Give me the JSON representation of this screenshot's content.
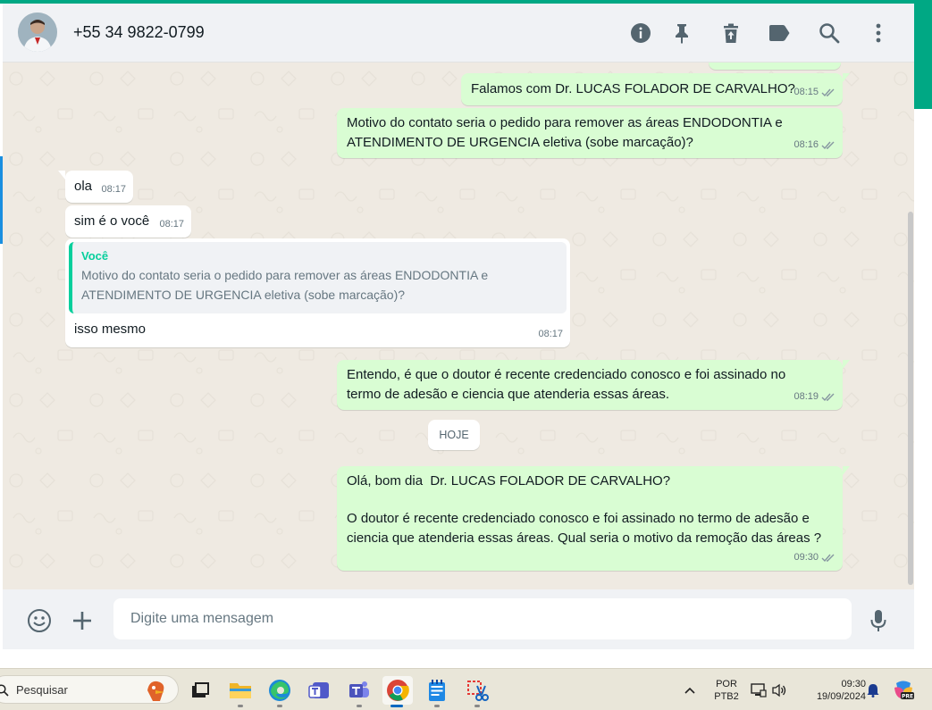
{
  "header": {
    "contact_name": "+55 34 9822-0799",
    "icons": [
      "info-icon",
      "pin-icon",
      "delete-icon",
      "label-icon",
      "search-icon",
      "menu-icon"
    ]
  },
  "messages": [
    {
      "type": "out",
      "text": "Falamos com Dr. LUCAS FOLADOR DE CARVALHO?",
      "time": "08:15"
    },
    {
      "type": "out",
      "text": "Motivo do contato seria o pedido para remover as áreas ENDODONTIA e ATENDIMENTO DE URGENCIA eletiva (sobe marcação)?",
      "time": "08:16"
    },
    {
      "type": "in",
      "text": "ola",
      "time": "08:17"
    },
    {
      "type": "in",
      "text": "sim é o você",
      "time": "08:17"
    },
    {
      "type": "in_reply",
      "quote_author": "Você",
      "quote_text": "Motivo do contato seria o pedido para remover as áreas ENDODONTIA e ATENDIMENTO DE URGENCIA eletiva (sobe marcação)?",
      "text": "isso mesmo",
      "time": "08:17"
    },
    {
      "type": "out",
      "text": "Entendo, é que o doutor é recente credenciado conosco e foi assinado no termo de adesão e ciencia que atenderia essas áreas.",
      "time": "08:19"
    },
    {
      "type": "out",
      "text_line1": "Olá, bom dia  Dr. LUCAS FOLADOR DE CARVALHO?",
      "text_line2": "O doutor é recente credenciado conosco e foi assinado no termo de adesão e ciencia que atenderia essas áreas. Qual seria o motivo da remoção das áreas ?",
      "time": "09:30"
    }
  ],
  "date_separator": "HOJE",
  "composer": {
    "placeholder": "Digite uma mensagem"
  },
  "taskbar": {
    "search_label": "Pesquisar",
    "language_line1": "POR",
    "language_line2": "PTB2",
    "time": "09:30",
    "date": "19/09/2024",
    "badge": "PRE"
  },
  "colors": {
    "accent": "#00a884",
    "outgoing_bubble": "#d9fdd3",
    "incoming_bubble": "#ffffff",
    "chat_background": "#efeae2",
    "quote_accent": "#06cf9c",
    "read_ticks": "#8696a0"
  }
}
